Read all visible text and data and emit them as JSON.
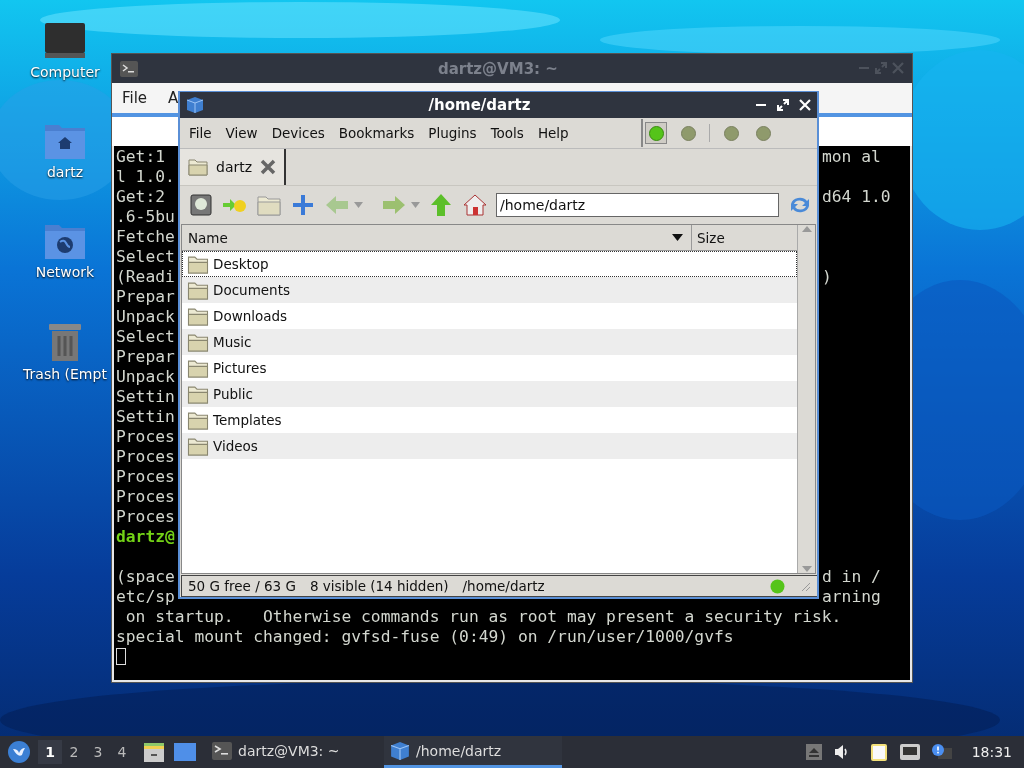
{
  "desktop_icons": [
    {
      "kind": "computer",
      "label": "Computer"
    },
    {
      "kind": "home",
      "label": "dartz"
    },
    {
      "kind": "network",
      "label": "Network"
    },
    {
      "kind": "trash",
      "label": "Trash (Empt"
    }
  ],
  "terminal": {
    "title": "dartz@VM3: ~",
    "menu": [
      "File",
      "A"
    ],
    "lines": [
      {
        "left": "Get:1",
        "right": "mon al"
      },
      {
        "left": "l 1.0."
      },
      {
        "left": "Get:2",
        "right": "d64 1.0"
      },
      {
        "left": ".6-5bu"
      },
      {
        "left": "Fetche"
      },
      {
        "left": "Select"
      },
      {
        "left": "(Readi",
        "right": ")"
      },
      {
        "left": "Prepar"
      },
      {
        "left": "Unpack"
      },
      {
        "left": "Select"
      },
      {
        "left": "Prepar"
      },
      {
        "left": "Unpack"
      },
      {
        "left": "Settin"
      },
      {
        "left": "Settin"
      },
      {
        "left": "Proces"
      },
      {
        "left": "Proces"
      },
      {
        "left": "Proces"
      },
      {
        "left": "Proces"
      },
      {
        "left": "Proces"
      },
      {
        "kind": "prompt",
        "left": "dartz@"
      },
      {
        "kind": "blank"
      },
      {
        "left": "(space",
        "right": "d in /"
      },
      {
        "left": "etc/sp",
        "right": "arning"
      },
      {
        "text": " on startup.   Otherwise commands run as root may present a security risk."
      },
      {
        "text": "special mount changed: gvfsd-fuse (0:49) on /run/user/1000/gvfs"
      },
      {
        "kind": "cursor"
      }
    ]
  },
  "file_manager": {
    "title": "/home/dartz",
    "menu": [
      "File",
      "View",
      "Devices",
      "Bookmarks",
      "Plugins",
      "Tools",
      "Help"
    ],
    "pane_buttons": [
      {
        "selected": true
      },
      {
        "selected": false
      },
      {
        "selected": false
      },
      {
        "selected": false
      }
    ],
    "tabs": [
      {
        "label": "dartz",
        "selected": true
      }
    ],
    "path": "/home/dartz",
    "columns": [
      "Name",
      "Size"
    ],
    "rows": [
      {
        "name": "Desktop",
        "focused": true
      },
      {
        "name": "Documents",
        "focused": false
      },
      {
        "name": "Downloads",
        "focused": false
      },
      {
        "name": "Music",
        "focused": false
      },
      {
        "name": "Pictures",
        "focused": false
      },
      {
        "name": "Public",
        "focused": false
      },
      {
        "name": "Templates",
        "focused": false
      },
      {
        "name": "Videos",
        "focused": false
      }
    ],
    "status": [
      "50 G free / 63 G",
      "8 visible (14 hidden)",
      "/home/dartz"
    ]
  },
  "taskbar": {
    "workspaces": [
      {
        "label": "1",
        "selected": true
      },
      {
        "label": "2",
        "selected": false
      },
      {
        "label": "3",
        "selected": false
      },
      {
        "label": "4",
        "selected": false
      }
    ],
    "tasks": [
      {
        "kind": "terminal",
        "label": "dartz@VM3: ~",
        "selected": false
      },
      {
        "kind": "files",
        "label": "/home/dartz",
        "selected": true
      }
    ],
    "clock": "18:31"
  }
}
